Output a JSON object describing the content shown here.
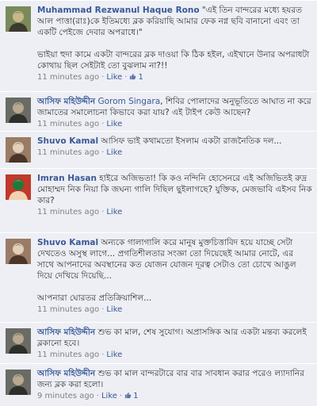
{
  "comments": [
    {
      "author": "Muhammad Rezwanul Haque Rono",
      "tag": "",
      "paragraphs": [
        "\"এই তিন বান্দরের মধ্যে হযরত আল পাত্তা(রাঃ)কে ইতিমধ্যে ব্লক করিয়াছি আমার ফেক নগ্ন ছবি বানানো এবং তা একটি পেইজে দেবার অপরাধে।\"",
        "ভাইয়া হুদা কামে একটা বান্দরের ব্লক দাওয়া কি ঠিক হইল, এইখানে উনার অপরাধটা কোথায় ছিল সেইটাই তো বুঝলাম না?!!"
      ],
      "time": "11 minutes ago",
      "like_label": "Like",
      "like_count": "1",
      "avatar_colors": [
        "#7a8a5a",
        "#c9b98a",
        "#3c3a2e"
      ]
    },
    {
      "author": "আসিফ মহিউদ্দীন",
      "tag": "Gorom Singara",
      "paragraphs": [
        ", শিবির পোলাদের অনুভূতিতে আঘাত না করে জামাতের সমালোচনা কিভাবে করা যায়? এই টাইপ কেউ আছেন?"
      ],
      "time": "11 minutes ago",
      "like_label": "Like",
      "like_count": "",
      "avatar_colors": [
        "#6b6b66",
        "#b8a890",
        "#2e2e2a"
      ]
    },
    {
      "author": "Shuvo Kamal",
      "tag": "",
      "paragraphs": [
        "আসিফ ভাই কথামতো ইসলাম একটা রাজনৈতিক দল..."
      ],
      "time": "11 minutes ago",
      "like_label": "Like",
      "like_count": "",
      "avatar_colors": [
        "#9a7c66",
        "#e2cfb8",
        "#4a3528"
      ]
    },
    {
      "author": "Imran Hasan",
      "tag": "",
      "paragraphs": [
        "হাইরে অজিভতা! কি কও নন্দিনি হোসেনরে এই অজিভিতই রুদ্র মোহাম্মদ নিক নিয়া কি জঘন্য গালি দিছিল ছুইলাগছে? যুক্তিক, মেজভাবি এইসব নিক কার?"
      ],
      "time": "11 minutes ago",
      "like_label": "Like",
      "like_count": "",
      "avatar_colors": [
        "#c0392b",
        "#1e7a3a",
        "#f2d0b0"
      ]
    },
    {
      "author": "Shuvo Kamal",
      "tag": "",
      "paragraphs": [
        "অন্যকে গালাগালি করে মানুষ মুক্তচিত্তাবিদ হয়ে যাচ্ছে সেটা দেখতেও অসুস্থ লাগে... প্রগতিশীলতার সংজ্ঞা তো দিয়েছেই আমার নোটে, এর সাথে আপনাদের অবস্থানের কত যোজন যোজন দূরত্ব সেটাও তো চোখে আঙুল দিয়ে দেখিয়ে দিয়েছি...",
        "আপনারা ঘোরতর প্রতিক্রিয়াশিল..."
      ],
      "time": "11 minutes ago",
      "like_label": "Like",
      "like_count": "",
      "avatar_colors": [
        "#9a7c66",
        "#e2cfb8",
        "#4a3528"
      ]
    },
    {
      "author": "আসিফ মহিউদ্দীন",
      "tag": "",
      "paragraphs": [
        "শুভ কা মাল, শেষ সুযোগ। অপ্রাসঙ্গিক আর একটা মন্তব্য করলেই ব্লকানো হবে।"
      ],
      "time": "11 minutes ago",
      "like_label": "Like",
      "like_count": "",
      "avatar_colors": [
        "#6b6b66",
        "#b8a890",
        "#2e2e2a"
      ]
    },
    {
      "author": "আসিফ মহিউদ্দীন",
      "tag": "",
      "paragraphs": [
        "শুভ কা মাল বান্দরটারে বার বার সাবধান করার পরেও ল্যাদানির জন্য ব্লক করা হলো।"
      ],
      "time": "9 minutes ago",
      "like_label": "Like",
      "like_count": "1",
      "avatar_colors": [
        "#6b6b66",
        "#b8a890",
        "#2e2e2a"
      ]
    }
  ],
  "meta_separator": "·"
}
